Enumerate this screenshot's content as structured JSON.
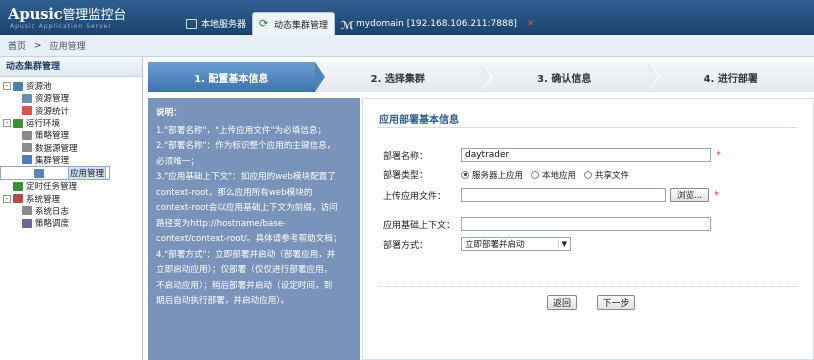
{
  "app": {
    "title": "Apusic",
    "title_cn": "管理监控台",
    "subtitle": "Apusic Application Server"
  },
  "tabs": [
    {
      "label": "本地服务器",
      "icon": "monitor-icon"
    },
    {
      "label": "动态集群管理",
      "icon": "refresh-icon",
      "active": true
    },
    {
      "label": "mydomain [192.168.106.211:7888]",
      "icon": "domain-icon"
    }
  ],
  "breadcrumb": {
    "home": "首页",
    "sep": ">",
    "current": "应用管理"
  },
  "sidebar": {
    "title": "动态集群管理",
    "items": [
      {
        "label": "资源池",
        "level": 1,
        "toggle": "-",
        "color": "#4a7fb5"
      },
      {
        "label": "资源管理",
        "level": 2,
        "color": "#6b8db3"
      },
      {
        "label": "资源统计",
        "level": 2,
        "color": "#d9534f"
      },
      {
        "label": "运行环境",
        "level": 1,
        "toggle": "-",
        "color": "#3c8d3c"
      },
      {
        "label": "策略管理",
        "level": 2,
        "color": "#8a8a8a"
      },
      {
        "label": "数据源管理",
        "level": 2,
        "color": "#8a8a8a"
      },
      {
        "label": "集群管理",
        "level": 2,
        "color": "#4a7fb5"
      },
      {
        "label": "应用管理",
        "level": 1,
        "color": "#5a86b8",
        "selected": true
      },
      {
        "label": "定时任务管理",
        "level": 1,
        "color": "#3c8d3c"
      },
      {
        "label": "系统管理",
        "level": 1,
        "toggle": "-",
        "color": "#b54a4a"
      },
      {
        "label": "系统日志",
        "level": 2,
        "color": "#8a8a8a"
      },
      {
        "label": "策略调度",
        "level": 2,
        "color": "#6a6a9a"
      }
    ]
  },
  "steps": [
    {
      "label": "1. 配置基本信息",
      "active": true
    },
    {
      "label": "2. 选择集群"
    },
    {
      "label": "3. 确认信息"
    },
    {
      "label": "4. 进行部署"
    }
  ],
  "note": {
    "title": "说明：",
    "lines": [
      "1.\"部署名称\"，\"上传应用文件\"为必填信息；",
      "2.\"部署名称\"：作为标识整个应用的主键信息，",
      "必须唯一；",
      "3.\"应用基础上下文\"：如应用的web模块配置了",
      "context-root，那么应用所有web模块的",
      "context-root会以应用基础上下文为前缀，访问",
      "路径变为http://hostname/base-",
      "context/context-root/。具体请参考帮助文档；",
      "4.\"部署方式\"：立即部署并启动（部署应用，并",
      "立即启动应用）；仅部署（仅仅进行部署应用，",
      "不启动应用）；稍后部署并启动（设定时间，到",
      "期后自动执行部署，并启动应用）。"
    ]
  },
  "form": {
    "title": "应用部署基本信息",
    "name_label": "部署名称：",
    "name_value": "daytrader",
    "type_label": "部署类型：",
    "type_options": [
      "服务器上应用",
      "本地应用",
      "共享文件"
    ],
    "upload_label": "上传应用文件：",
    "upload_value": "",
    "browse_label": "浏览...",
    "context_label": "应用基础上下文：",
    "context_value": "",
    "mode_label": "部署方式：",
    "mode_value": "立即部署并启动",
    "required_mark": "*",
    "back_label": "返回",
    "next_label": "下一步"
  }
}
